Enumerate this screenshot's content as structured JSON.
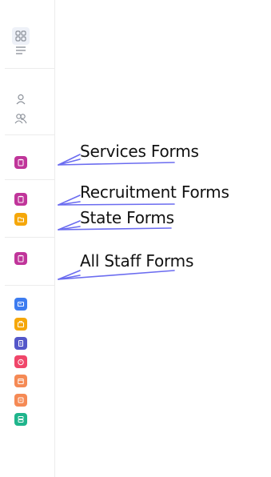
{
  "sidebar": {
    "top_icons": [
      "grid-icon",
      "menu-icon"
    ],
    "people_icons": [
      "user-icon",
      "users-icon"
    ],
    "form_items": [
      {
        "icon": "clipboard-icon",
        "color": "#c0359a"
      },
      {
        "icon": "clipboard-icon",
        "color": "#c0359a"
      },
      {
        "icon": "folder-icon",
        "color": "#f5a70a"
      },
      {
        "icon": "clipboard-icon",
        "color": "#c0359a"
      }
    ],
    "bottom_apps": [
      {
        "icon": "card-icon",
        "color": "#3d7cf0"
      },
      {
        "icon": "briefcase-icon",
        "color": "#f5a70a"
      },
      {
        "icon": "document-icon",
        "color": "#5457c9"
      },
      {
        "icon": "timer-icon",
        "color": "#f0466a"
      },
      {
        "icon": "calendar-icon",
        "color": "#f58a55"
      },
      {
        "icon": "box-icon",
        "color": "#f58a55"
      },
      {
        "icon": "flow-icon",
        "color": "#1fb58c"
      }
    ]
  },
  "annotations": {
    "services_forms": "Services Forms",
    "recruitment_forms": "Recruitment Forms",
    "state_forms": "State Forms",
    "all_staff_forms": "All Staff Forms"
  },
  "colors": {
    "arrow": "#6b6cf0",
    "divider": "#ececec",
    "icon_gray": "#8a8f98"
  }
}
